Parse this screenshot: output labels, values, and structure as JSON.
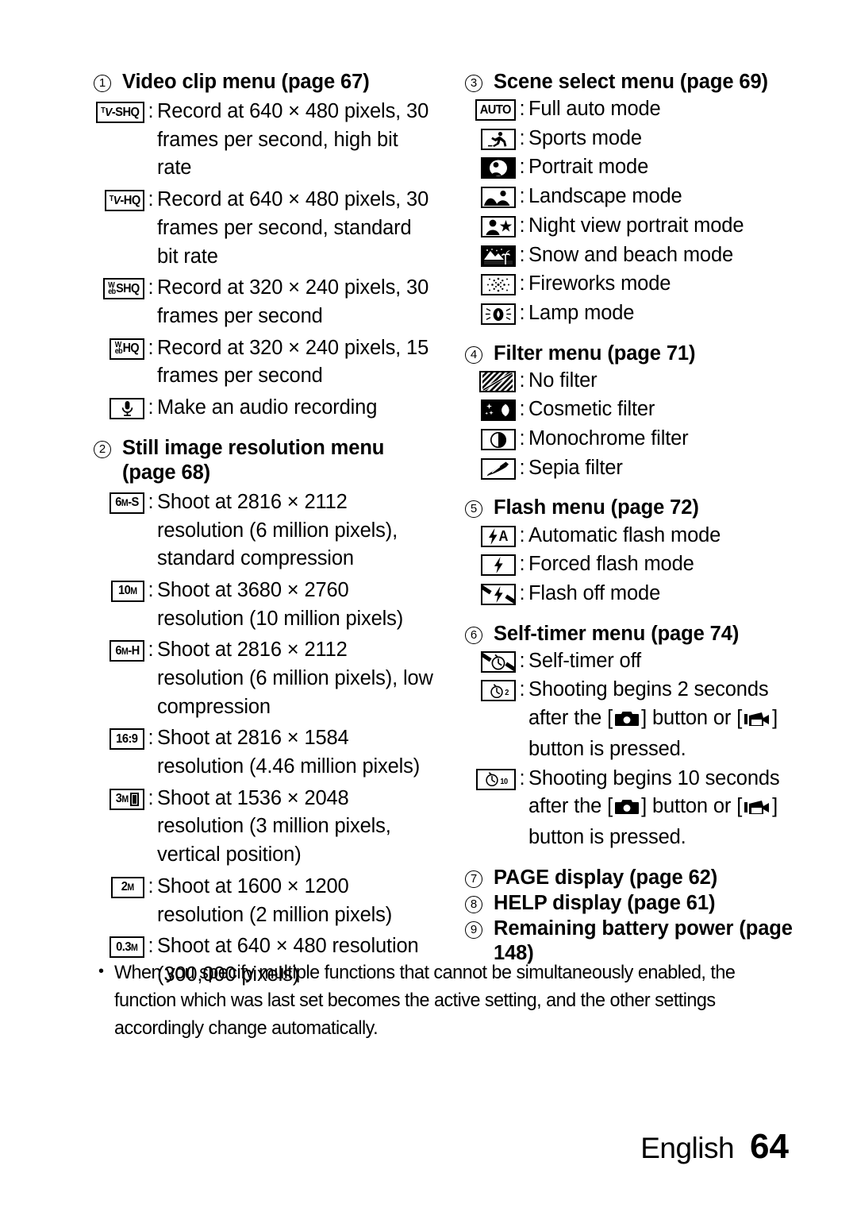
{
  "page": {
    "footer_language": "English",
    "footer_page_number": "64"
  },
  "sections": [
    {
      "number": "1",
      "title": "Video clip menu (page 67)",
      "column": "left",
      "items": [
        {
          "icon": "tv-shq-icon",
          "icon_label": "TV-SHQ",
          "text": "Record at 640 × 480 pixels, 30 frames per second, high bit rate"
        },
        {
          "icon": "tv-hq-icon",
          "icon_label": "TV-HQ",
          "text": "Record at 640 × 480 pixels, 30 frames per second, standard bit rate"
        },
        {
          "icon": "web-shq-icon",
          "icon_label": "WebSHQ",
          "text": "Record at 320 × 240 pixels, 30 frames per second"
        },
        {
          "icon": "web-hq-icon",
          "icon_label": "WebHQ",
          "text": "Record at 320 × 240 pixels, 15 frames per second"
        },
        {
          "icon": "microphone-icon",
          "icon_label": "",
          "text": "Make an audio recording"
        }
      ]
    },
    {
      "number": "2",
      "title": "Still image resolution menu (page 68)",
      "column": "left",
      "items": [
        {
          "icon": "res-6m-s-icon",
          "icon_label": "6M-S",
          "text": "Shoot at 2816 × 2112 resolution (6 million pixels), standard compression"
        },
        {
          "icon": "res-10m-icon",
          "icon_label": "10M",
          "text": "Shoot at 3680 × 2760 resolution (10 million pixels)"
        },
        {
          "icon": "res-6m-h-icon",
          "icon_label": "6M-H",
          "text": "Shoot at 2816 × 2112 resolution (6 million pixels), low compression"
        },
        {
          "icon": "res-16-9-icon",
          "icon_label": "16:9",
          "text": "Shoot at 2816 × 1584 resolution (4.46 million pixels)"
        },
        {
          "icon": "res-3m-vertical-icon",
          "icon_label": "3M",
          "text": "Shoot at 1536 × 2048 resolution (3 million pixels, vertical position)"
        },
        {
          "icon": "res-2m-icon",
          "icon_label": "2M",
          "text": "Shoot at 1600 × 1200 resolution (2 million pixels)"
        },
        {
          "icon": "res-0-3m-icon",
          "icon_label": "0.3M",
          "text": "Shoot at 640 × 480 resolution (300,000 pixels)"
        }
      ]
    },
    {
      "number": "3",
      "title": "Scene select menu (page 69)",
      "column": "right",
      "items": [
        {
          "icon": "auto-mode-icon",
          "icon_label": "AUTO",
          "text": "Full auto mode"
        },
        {
          "icon": "sports-mode-icon",
          "icon_label": "",
          "text": "Sports mode"
        },
        {
          "icon": "portrait-mode-icon",
          "icon_label": "",
          "text": "Portrait mode"
        },
        {
          "icon": "landscape-mode-icon",
          "icon_label": "",
          "text": "Landscape mode"
        },
        {
          "icon": "night-view-portrait-icon",
          "icon_label": "",
          "text": "Night view portrait mode"
        },
        {
          "icon": "snow-beach-mode-icon",
          "icon_label": "",
          "text": "Snow and beach mode"
        },
        {
          "icon": "fireworks-mode-icon",
          "icon_label": "",
          "text": "Fireworks mode"
        },
        {
          "icon": "lamp-mode-icon",
          "icon_label": "",
          "text": "Lamp mode"
        }
      ]
    },
    {
      "number": "4",
      "title": "Filter menu (page 71)",
      "column": "right",
      "items": [
        {
          "icon": "no-filter-icon",
          "icon_label": "",
          "text": "No filter"
        },
        {
          "icon": "cosmetic-filter-icon",
          "icon_label": "",
          "text": "Cosmetic filter"
        },
        {
          "icon": "monochrome-filter-icon",
          "icon_label": "",
          "text": "Monochrome filter"
        },
        {
          "icon": "sepia-filter-icon",
          "icon_label": "",
          "text": "Sepia filter"
        }
      ]
    },
    {
      "number": "5",
      "title": "Flash menu (page 72)",
      "column": "right",
      "items": [
        {
          "icon": "flash-auto-icon",
          "icon_label": "A",
          "text": "Automatic flash mode"
        },
        {
          "icon": "flash-forced-icon",
          "icon_label": "",
          "text": "Forced flash mode"
        },
        {
          "icon": "flash-off-icon",
          "icon_label": "",
          "text": "Flash off mode"
        }
      ]
    },
    {
      "number": "6",
      "title": "Self-timer menu (page 74)",
      "column": "right",
      "items": [
        {
          "icon": "self-timer-off-icon",
          "icon_label": "",
          "text": "Self-timer off"
        },
        {
          "icon": "self-timer-2s-icon",
          "icon_label": "2",
          "text_before": "Shooting begins 2 seconds after the [",
          "text_mid": "] button or [",
          "text_after": "] button is pressed."
        },
        {
          "icon": "self-timer-10s-icon",
          "icon_label": "10",
          "text_before": "Shooting begins 10 seconds after the [",
          "text_mid": "] button or [",
          "text_after": "] button is pressed."
        }
      ]
    }
  ],
  "plain_sections": [
    {
      "number": "7",
      "title": "PAGE display (page 62)"
    },
    {
      "number": "8",
      "title": "HELP display (page 61)"
    },
    {
      "number": "9",
      "title": "Remaining battery power (page 148)"
    }
  ],
  "note": {
    "bullet": "•",
    "text": "When you specify multiple functions that cannot be simultaneously enabled, the function which was last set becomes the active setting, and the other settings accordingly change automatically."
  }
}
